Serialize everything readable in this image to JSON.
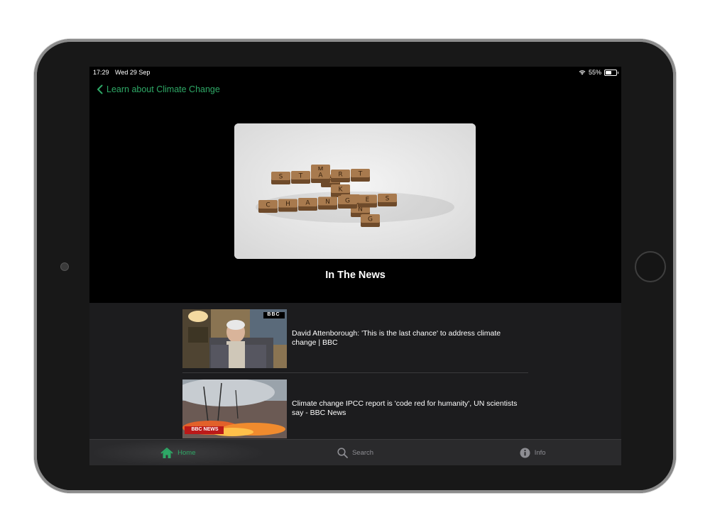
{
  "status_bar": {
    "time": "17:29",
    "date": "Wed 29 Sep",
    "battery": "55%",
    "battery_level": 0.55
  },
  "nav": {
    "back_label": "Learn about Climate Change"
  },
  "hero": {
    "tiles_row1": "START",
    "tiles_row2": "CHANGES",
    "tiles_vertical": "MAKING"
  },
  "section": {
    "title": "In The News"
  },
  "news": [
    {
      "title": "David Attenborough: 'This is the last chance' to address climate change | BBC",
      "badge": "BBC"
    },
    {
      "title": "Climate change IPCC report is 'code red for humanity', UN scientists say - BBC News",
      "badge": "BBC NEWS"
    }
  ],
  "tabs": [
    {
      "label": "Home",
      "icon": "house-icon",
      "active": true
    },
    {
      "label": "Search",
      "icon": "magnifier-icon",
      "active": false
    },
    {
      "label": "Info",
      "icon": "info-icon",
      "active": false
    }
  ],
  "colors": {
    "accent": "#2ea866",
    "panel": "#1c1c1e",
    "tab_bar": "#2a2a2c"
  }
}
